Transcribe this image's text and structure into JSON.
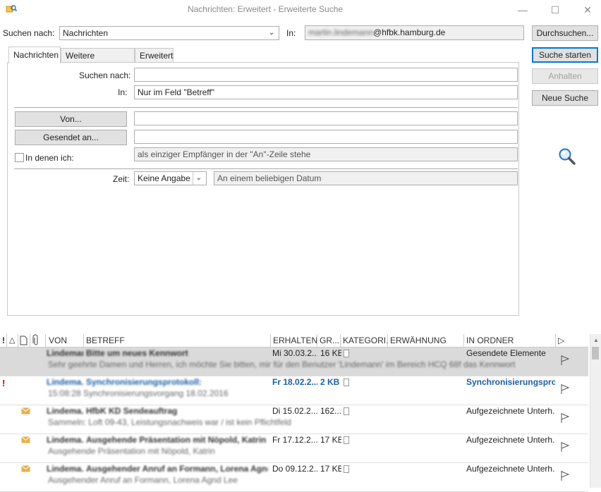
{
  "window": {
    "title": "Nachrichten: Erweitert - Erweiterte Suche",
    "minimize": "—",
    "maximize": "☐",
    "close": "✕"
  },
  "search": {
    "look_for_label": "Suchen nach:",
    "look_for_value": "Nachrichten",
    "in_label": "In:",
    "in_value_blurred": "martin.lindemann",
    "in_value_domain": "@hfbk.hamburg.de",
    "browse_button": "Durchsuchen..."
  },
  "actions": {
    "find_now": "Suche starten",
    "stop": "Anhalten",
    "new_search": "Neue Suche"
  },
  "tabs": [
    "Nachrichten",
    "Weitere Optionen",
    "Erweitert"
  ],
  "form": {
    "search_for_label": "Suchen nach:",
    "search_for_value": "",
    "in_label": "In:",
    "in_value": "Nur im Feld \"Betreff\"",
    "from_button": "Von...",
    "sent_to_button": "Gesendet an...",
    "where_i_am_label": "In denen ich:",
    "where_i_am_value": "als einziger Empfänger in der \"An\"-Zeile stehe",
    "time_label": "Zeit:",
    "time_value": "Keine Angabe",
    "time_range_value": "An einem beliebigen Datum"
  },
  "columns": {
    "importance": "!",
    "reminder": "△",
    "icon": "🗋",
    "attachment": "📎",
    "from": "VON",
    "subject": "BETREFF",
    "received": "ERHALTEN",
    "size": "GR...",
    "categories": "KATEGORI...",
    "mention": "ERWÄHNUNG",
    "in_folder": "IN ORDNER",
    "flag": "▷"
  },
  "results": [
    {
      "from": "Lindemann",
      "subject": "Bitte um neues Kennwort",
      "preview": "Sehr geehrte Damen und Herren,  ich möchte Sie bitten, mir für den Benutzer 'Lindemann' im Bereich HCQ 68f das Kennwort",
      "received": "Mi 30.03.2...",
      "size": "16 KB",
      "folder": "Gesendete Elemente",
      "important": false,
      "icon": "",
      "selected": true,
      "unread": false
    },
    {
      "from": "Lindema...",
      "subject": "Synchronisierungsprotokoll:",
      "preview": "15:08:28 Synchronisierungsvorgang 18.02.2016",
      "received": "Fr 18.02.2...",
      "size": "2 KB",
      "folder": "Synchronisierungspro...",
      "important": true,
      "icon": "",
      "selected": false,
      "unread": true
    },
    {
      "from": "Lindema...",
      "subject": "HfbK KD Sendeauftrag",
      "preview": "Sammeln: Loft 09-43,  Leistungsnachweis war / ist kein Pflichtfeld",
      "received": "Di 15.02.2...",
      "size": "162...",
      "folder": "Aufgezeichnete Unterh...",
      "important": false,
      "icon": "envelope",
      "selected": false,
      "unread": false
    },
    {
      "from": "Lindema...",
      "subject": "Ausgehende Präsentation mit Nöpold, Katrin",
      "preview": "Ausgehende Präsentation mit Nöpold, Katrin",
      "received": "Fr 17.12.2...",
      "size": "17 KB",
      "folder": "Aufgezeichnete Unterh...",
      "important": false,
      "icon": "envelope",
      "selected": false,
      "unread": false
    },
    {
      "from": "Lindema...",
      "subject": "Ausgehender Anruf an Formann, Lorena Agnd ...",
      "preview": "Ausgehender Anruf an Formann, Lorena Agnd Lee",
      "received": "Do 09.12.2...",
      "size": "17 KB",
      "folder": "Aufgezeichnete Unterh...",
      "important": false,
      "icon": "envelope",
      "selected": false,
      "unread": false
    }
  ],
  "colors": {
    "accent": "#0078d7",
    "importance": "#d00000",
    "unread_blue": "#1a5fa8",
    "envelope": "#e8b04a"
  },
  "icons": {
    "app": "outlook-search-icon",
    "magnifier": "magnifier-icon",
    "flag": "flag-icon",
    "envelope": "envelope-icon"
  }
}
